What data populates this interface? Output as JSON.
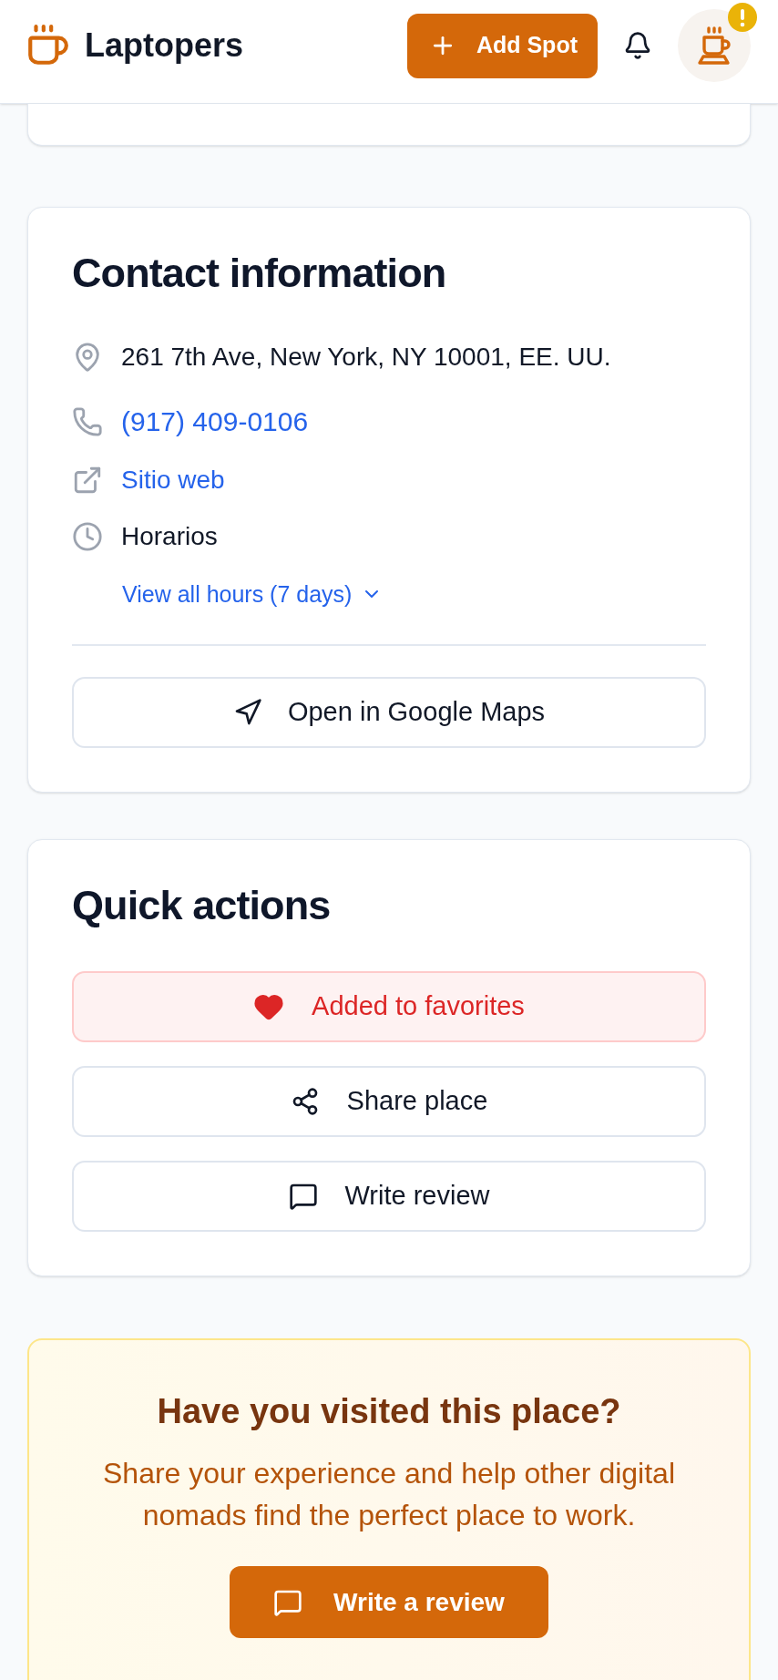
{
  "header": {
    "brand": "Laptopers",
    "add_button": "Add Spot",
    "avatar": {
      "alert": true
    }
  },
  "contact": {
    "title": "Contact information",
    "items": [
      {
        "kind": "address",
        "text": "261 7th Ave, New York, NY 10001, EE. UU."
      },
      {
        "kind": "phone",
        "text": "(917) 409-0106"
      },
      {
        "kind": "website",
        "text": "Sitio web"
      },
      {
        "kind": "hours",
        "text": "Horarios"
      }
    ],
    "hours_toggle": {
      "label": "View all hours (7 days)",
      "expanded": false
    },
    "maps_button": "Open in Google Maps"
  },
  "quick_actions": {
    "title": "Quick actions",
    "buttons": [
      {
        "kind": "favorite",
        "label": "Added to favorites",
        "active": true
      },
      {
        "kind": "share",
        "label": "Share place",
        "active": false
      },
      {
        "kind": "review",
        "label": "Write review",
        "active": false
      }
    ]
  },
  "review_prompt": {
    "title": "Have you visited this place?",
    "text": "Share your experience and help other digital nomads find the perfect place to work.",
    "button": "Write a review"
  }
}
